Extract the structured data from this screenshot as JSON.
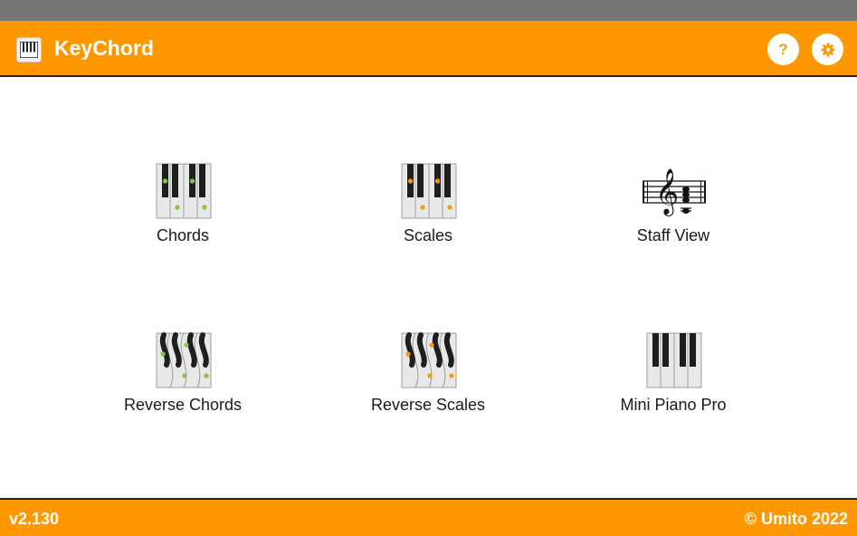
{
  "app": {
    "title": "KeyChord"
  },
  "icons": {
    "logo": "piano-keys-icon",
    "help": "help-icon",
    "settings": "gear-icon"
  },
  "help": {
    "glyph": "?"
  },
  "tiles": [
    {
      "label": "Chords",
      "icon": "piano-chord-icon"
    },
    {
      "label": "Scales",
      "icon": "piano-scale-icon"
    },
    {
      "label": "Staff View",
      "icon": "treble-staff-icon"
    },
    {
      "label": "Reverse Chords",
      "icon": "wavy-piano-chord-icon"
    },
    {
      "label": "Reverse Scales",
      "icon": "wavy-piano-scale-icon"
    },
    {
      "label": "Mini Piano Pro",
      "icon": "mini-piano-icon"
    }
  ],
  "footer": {
    "version": "v2.130",
    "copyright": "© Umito 2022"
  },
  "colors": {
    "accent": "#ff9800",
    "status_bar": "#757575",
    "chord_dot": "#8bc34a",
    "scale_dot": "#ff9800"
  }
}
